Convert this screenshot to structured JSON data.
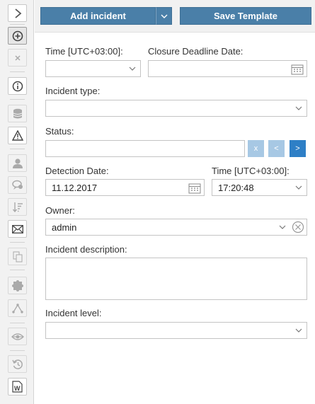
{
  "toolbar": {
    "add_incident": "Add incident",
    "save_template": "Save Template"
  },
  "form": {
    "time_label": "Time [UTC+03:00]:",
    "time_value": "",
    "closure_label": "Closure Deadline Date:",
    "closure_value": "",
    "incident_type_label": "Incident type:",
    "incident_type_value": "",
    "status_label": "Status:",
    "status_value": "",
    "status_buttons": {
      "clear": "x",
      "prev": "<",
      "next": ">"
    },
    "detection_date_label": "Detection Date:",
    "detection_date_value": "11.12.2017",
    "detection_time_label": "Time [UTC+03:00]:",
    "detection_time_value": "17:20:48",
    "owner_label": "Owner:",
    "owner_value": "admin",
    "description_label": "Incident description:",
    "description_value": "",
    "level_label": "Incident level:",
    "level_value": ""
  },
  "colors": {
    "primary_button": "#4a7fa8",
    "nav_button_light": "#a7c8e4",
    "nav_button_active": "#2e7fc6"
  },
  "sidebar_icons": [
    "chevron-right-icon",
    "plus-circle-icon",
    "close-icon",
    "info-icon",
    "database-icon",
    "warning-icon",
    "user-icon",
    "comments-icon",
    "sort-icon",
    "mail-icon",
    "copy-icon",
    "puzzle-icon",
    "graph-icon",
    "eye-icon",
    "history-icon",
    "word-doc-icon"
  ]
}
